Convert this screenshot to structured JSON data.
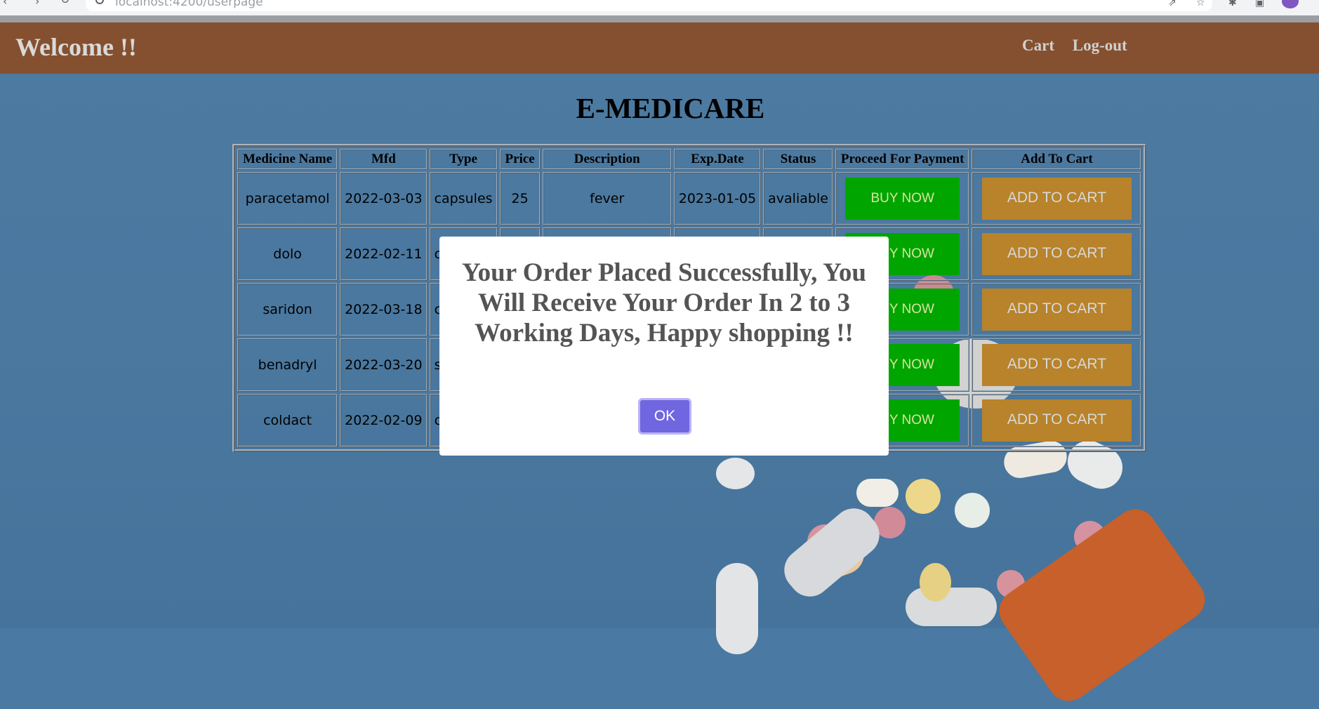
{
  "browser": {
    "url_host": "localhost",
    "url_path": ":4200/userpage"
  },
  "header": {
    "welcome": "Welcome !!",
    "links": [
      "Cart",
      "Log-out"
    ]
  },
  "page_title": "E-MEDICARE",
  "table": {
    "headers": [
      "Medicine Name",
      "Mfd",
      "Type",
      "Price",
      "Description",
      "Exp.Date",
      "Status",
      "Proceed For Payment",
      "Add To Cart"
    ],
    "rows": [
      {
        "name": "paracetamol",
        "mfd": "2022-03-03",
        "type": "capsules",
        "price": "25",
        "description": "fever",
        "exp": "2023-01-05",
        "status": "avaliable"
      },
      {
        "name": "dolo",
        "mfd": "2022-02-11",
        "type": "ca",
        "price": "",
        "description": "",
        "exp": "",
        "status": ""
      },
      {
        "name": "saridon",
        "mfd": "2022-03-18",
        "type": "ca",
        "price": "",
        "description": "",
        "exp": "",
        "status": ""
      },
      {
        "name": "benadryl",
        "mfd": "2022-03-20",
        "type": "s",
        "price": "",
        "description": "",
        "exp": "",
        "status": ""
      },
      {
        "name": "coldact",
        "mfd": "2022-02-09",
        "type": "ca",
        "price": "",
        "description": "",
        "exp": "",
        "status": ""
      }
    ],
    "buy_label": "BUY NOW",
    "add_label": "ADD TO CART"
  },
  "modal": {
    "message": "Your Order Placed Successfully, You Will Receive Your Order In 2 to 3 Working Days, Happy shopping !!",
    "ok_label": "OK"
  },
  "colors": {
    "header_bg": "#85502f",
    "buy_bg": "#00a500",
    "add_bg": "#b8832a",
    "ok_bg": "#7066e0"
  }
}
